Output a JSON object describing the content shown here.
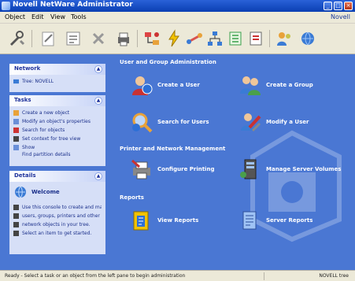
{
  "window": {
    "title": "Novell NetWare Administrator",
    "minimize_glyph": "_",
    "maximize_glyph": "□",
    "close_glyph": "×"
  },
  "menubar": {
    "items": [
      "Object",
      "Edit",
      "View",
      "Tools"
    ],
    "right_label": "Novell"
  },
  "toolbar": {
    "buttons": [
      {
        "icon": "tools-icon"
      },
      {
        "icon": "edit-icon"
      },
      {
        "icon": "properties-icon"
      },
      {
        "icon": "delete-icon"
      },
      {
        "icon": "print-icon"
      },
      {
        "icon": "hierarchy-icon"
      },
      {
        "icon": "lightning-icon"
      },
      {
        "icon": "network-icon"
      },
      {
        "icon": "tree-icon"
      },
      {
        "icon": "list-icon"
      },
      {
        "icon": "config-icon"
      },
      {
        "icon": "users-icon"
      },
      {
        "icon": "globe-icon"
      }
    ]
  },
  "panes": {
    "network": {
      "title": "Network",
      "chevron": "▲",
      "rows": [
        {
          "label": "Tree: NOVELL"
        }
      ]
    },
    "tasks": {
      "title": "Tasks",
      "chevron": "▲",
      "rows": [
        {
          "label": "Create a new object"
        },
        {
          "label": "Modify an object's properties"
        },
        {
          "label": "Search for objects"
        },
        {
          "label": "Set context for tree view"
        },
        {
          "label": "Show"
        }
      ],
      "sub": "Find partition details"
    },
    "details": {
      "title": "Details",
      "chevron": "▲",
      "heading": "Welcome",
      "lines": [
        "Use this console to create and manage",
        "users, groups, printers and other",
        "network objects in your tree.",
        "Select an item to get started."
      ]
    }
  },
  "content": {
    "sections": [
      {
        "title": "User and Group Administration",
        "items": [
          {
            "icon": "user-icon",
            "label": "Create a User"
          },
          {
            "icon": "group-icon",
            "label": "Create a Group"
          },
          {
            "icon": "search-icon",
            "label": "Search for Users"
          },
          {
            "icon": "tools-icon",
            "label": "Modify a User"
          }
        ]
      },
      {
        "title": "Printer and Network Management",
        "items": [
          {
            "icon": "printer-icon",
            "label": "Configure Printing"
          },
          {
            "icon": "server-icon",
            "label": "Manage Server Volumes"
          }
        ]
      },
      {
        "title": "Reports",
        "items": [
          {
            "icon": "report-icon",
            "label": "View Reports"
          },
          {
            "icon": "server-report-icon",
            "label": "Server Reports"
          }
        ]
      }
    ]
  },
  "statusbar": {
    "left": "Ready - Select a task or an object from the left pane to begin administration",
    "right": "NOVELL tree"
  }
}
